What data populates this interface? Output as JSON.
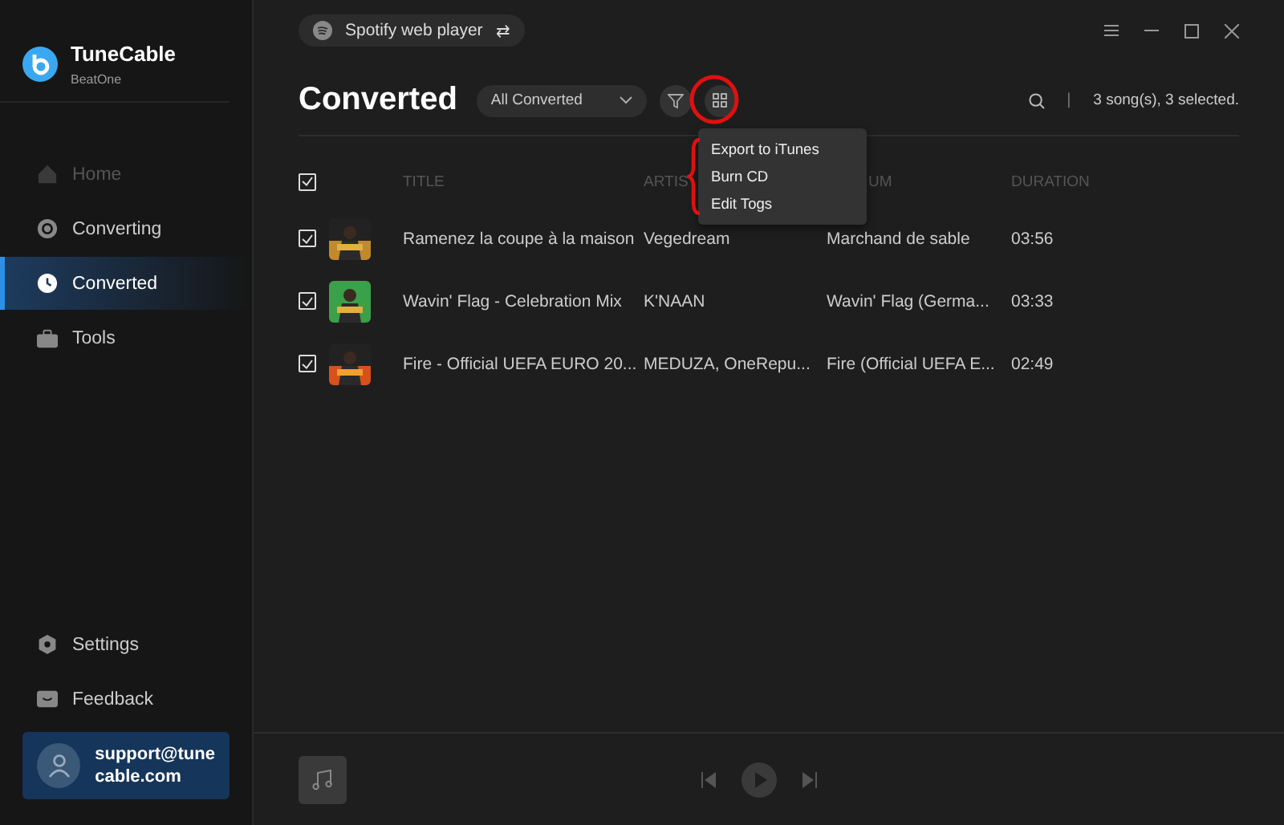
{
  "app": {
    "name": "TuneCable",
    "subtitle": "BeatOne"
  },
  "source_button": {
    "label": "Spotify web player",
    "swap": "⇄"
  },
  "sidebar": {
    "items": [
      {
        "label": "Home",
        "selected": false,
        "disabled": true
      },
      {
        "label": "Converting",
        "selected": false,
        "disabled": false
      },
      {
        "label": "Converted",
        "selected": true,
        "disabled": false
      },
      {
        "label": "Tools",
        "selected": false,
        "disabled": false
      }
    ],
    "bottom_items": [
      {
        "label": "Settings"
      },
      {
        "label": "Feedback"
      }
    ],
    "account": {
      "email_lines": [
        "support@tune",
        "cable.com"
      ]
    }
  },
  "page": {
    "title": "Converted",
    "filter_select": "All Converted",
    "summary": "3 song(s), 3 selected.",
    "separator": "|"
  },
  "menu": {
    "items": [
      "Export to iTunes",
      "Burn CD",
      "Edit Togs"
    ]
  },
  "table": {
    "select_all_checked": true,
    "columns": [
      "TITLE",
      "ARTIS",
      "UM",
      "DURATION"
    ],
    "rows": [
      {
        "checked": true,
        "title": "Ramenez la coupe à la maison",
        "artist": "Vegedream",
        "album": "Marchand de sable",
        "duration": "03:56"
      },
      {
        "checked": true,
        "title": "Wavin' Flag - Celebration Mix",
        "artist": "K'NAAN",
        "album": "Wavin' Flag (Germa...",
        "duration": "03:33"
      },
      {
        "checked": true,
        "title": "Fire - Official UEFA EURO 20...",
        "artist": "MEDUZA, OneRepu...",
        "album": "Fire (Official UEFA E...",
        "duration": "02:49"
      }
    ]
  }
}
